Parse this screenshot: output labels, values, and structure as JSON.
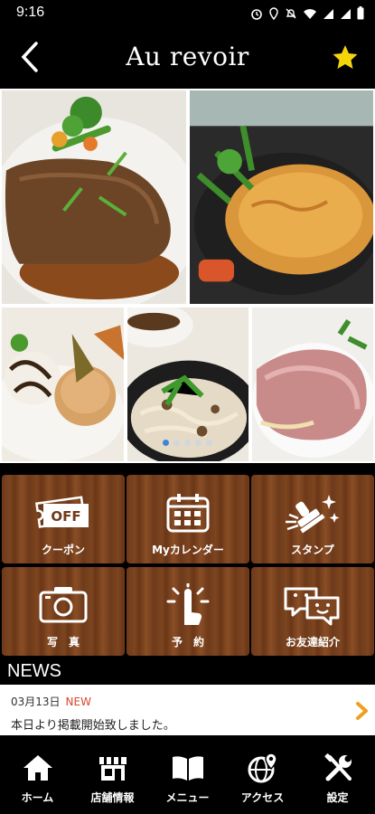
{
  "status_bar": {
    "time": "9:16"
  },
  "header": {
    "title": "Au revoir"
  },
  "collage": {
    "page_count": 5,
    "active_page": 1
  },
  "menu": [
    {
      "label": "クーポン",
      "icon": "coupon-icon",
      "badge": "OFF"
    },
    {
      "label": "Myカレンダー",
      "icon": "calendar-icon"
    },
    {
      "label": "スタンプ",
      "icon": "stamp-icon"
    },
    {
      "label": "写　真",
      "icon": "camera-icon"
    },
    {
      "label": "予　約",
      "icon": "reservation-icon"
    },
    {
      "label": "お友達紹介",
      "icon": "friend-referral-icon"
    }
  ],
  "news": {
    "heading": "NEWS",
    "date": "03月13日",
    "new_label": "NEW",
    "text": "本日より掲載開始致しました。"
  },
  "bottom_nav": [
    {
      "label": "ホーム",
      "icon": "home-icon"
    },
    {
      "label": "店舗情報",
      "icon": "store-icon"
    },
    {
      "label": "メニュー",
      "icon": "menu-book-icon"
    },
    {
      "label": "アクセス",
      "icon": "access-globe-icon"
    },
    {
      "label": "設定",
      "icon": "settings-tools-icon"
    }
  ],
  "colors": {
    "accent_star": "#f5d60a",
    "news_new": "#d8472c",
    "arrow": "#f0a020",
    "wood": "#7d4520"
  }
}
